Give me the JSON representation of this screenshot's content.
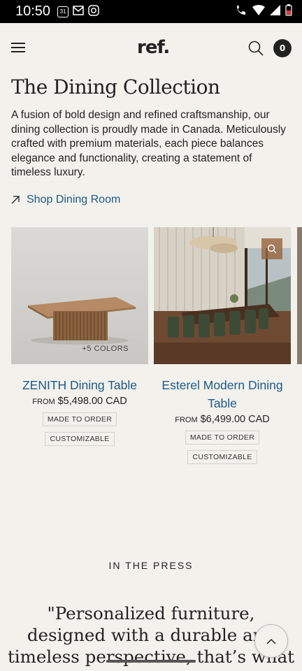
{
  "status_bar": {
    "time": "10:50",
    "calendar_day": "31"
  },
  "header": {
    "logo": "ref.",
    "cart_count": "0"
  },
  "page": {
    "title": "The Dining Collection",
    "intro": "A fusion of bold design and refined craftsmanship, our dining collection is proudly made in Canada. Meticulously crafted with premium materials, each piece balances elegance and functionality, creating a statement of timeless luxury.",
    "shop_link": "Shop Dining Room"
  },
  "products": [
    {
      "name": "ZENITH Dining Table",
      "price_prefix": "FROM",
      "price": "$5,498.00 CAD",
      "colors_tag": "+5 COLORS",
      "badges": [
        "MADE TO ORDER",
        "CUSTOMIZABLE"
      ]
    },
    {
      "name": "Esterel Modern Dining Table",
      "price_prefix": "FROM",
      "price": "$6,499.00 CAD",
      "badges": [
        "MADE TO ORDER",
        "CUSTOMIZABLE"
      ]
    }
  ],
  "press": {
    "label": "IN THE PRESS",
    "quote": "\"Personalized furniture, designed with a durable and timeless perspective, that’s what ref."
  },
  "colors": {
    "link": "#1e5a86",
    "background": "#f2f1ec",
    "text": "#222222"
  },
  "icons": [
    "menu-icon",
    "search-icon",
    "cart-icon",
    "arrow-up-right-icon",
    "zoom-icon",
    "chevron-up-icon"
  ]
}
